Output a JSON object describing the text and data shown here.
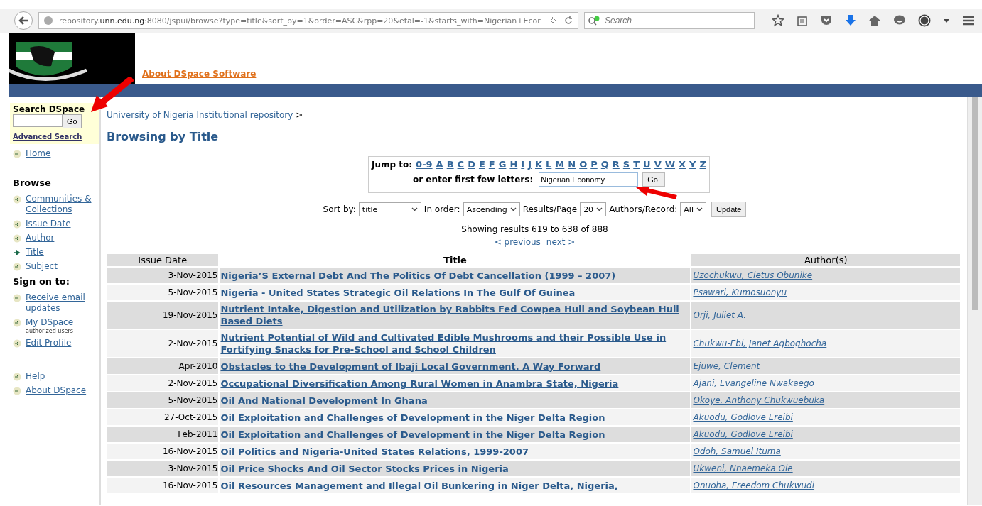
{
  "browser": {
    "url_host_pre": "repository.",
    "url_host": "unn.edu.ng",
    "url_rest": ":8080/jspui/browse?type=title&sort_by=1&order=ASC&rpp=20&etal=-1&starts_with=Nigerian+Ecor",
    "search_placeholder": "Search"
  },
  "header": {
    "about_link": "About DSpace Software"
  },
  "sidebar": {
    "search_title": "Search DSpace",
    "go": "Go",
    "advanced": "Advanced Search",
    "home": {
      "label": "Home",
      "selected": false
    },
    "browse_title": "Browse",
    "browse_items": [
      {
        "label": "Communities & Collections",
        "selected": false
      },
      {
        "label": "Issue Date",
        "selected": false
      },
      {
        "label": "Author",
        "selected": false
      },
      {
        "label": "Title",
        "selected": true
      },
      {
        "label": "Subject",
        "selected": false
      }
    ],
    "sign_title": "Sign on to:",
    "sign_items": [
      {
        "label": "Receive email updates",
        "selected": false
      },
      {
        "label": "My DSpace",
        "note": "authorized users",
        "selected": false
      },
      {
        "label": "Edit Profile",
        "selected": false
      }
    ],
    "help_items": [
      {
        "label": "Help",
        "selected": false
      },
      {
        "label": "About DSpace",
        "selected": false
      }
    ]
  },
  "breadcrumb": {
    "link": "University of Nigeria Institutional repository",
    "sep": ">"
  },
  "heading": "Browsing by Title",
  "jump": {
    "label": "Jump to:",
    "links": [
      "0-9",
      "A",
      "B",
      "C",
      "D",
      "E",
      "F",
      "G",
      "H",
      "I",
      "J",
      "K",
      "L",
      "M",
      "N",
      "O",
      "P",
      "Q",
      "R",
      "S",
      "T",
      "U",
      "V",
      "W",
      "X",
      "Y",
      "Z"
    ],
    "enter_label": "or enter first few letters:",
    "value": "Nigerian Economy",
    "go": "Go!"
  },
  "sort": [
    {
      "label": "Sort by:",
      "value": "title"
    },
    {
      "label": "In order:",
      "value": "Ascending"
    },
    {
      "label": "Results/Page",
      "value": "20"
    },
    {
      "label": "Authors/Record:",
      "value": "All"
    }
  ],
  "update": "Update",
  "showing": "Showing results 619 to 638 of 888",
  "prev": "< previous",
  "next": "next >",
  "table": {
    "columns": [
      "Issue Date",
      "Title",
      "Author(s)"
    ],
    "rows": [
      {
        "date": "3-Nov-2015",
        "title": "Nigeria’S External Debt And The Politics Of Debt Cancellation (1999 – 2007)",
        "author": "Uzochukwu, Cletus Obunike"
      },
      {
        "date": "5-Nov-2015",
        "title": "Nigeria - United States Strategic Oil Relations In The Gulf Of Guinea",
        "author": "Psawari, Kumosuonyu"
      },
      {
        "date": "19-Nov-2015",
        "title": "Nutrient Intake, Digestion and Utilization by Rabbits Fed Cowpea Hull and Soybean Hull Based Diets",
        "author": "Orji, Juliet A."
      },
      {
        "date": "2-Nov-2015",
        "title": "Nutrient Potential of Wild and Cultivated Edible Mushrooms and their Possible Use in Fortifying Snacks for Pre-School and School Children",
        "author": "Chukwu-Ebi, Janet Agboghocha"
      },
      {
        "date": "Apr-2010",
        "title": "Obstacles to the Development of Ibaji Local Government. A Way Forward",
        "author": "Ejuwe, Clement"
      },
      {
        "date": "2-Nov-2015",
        "title": "Occupational Diversification Among Rural Women in Anambra State, Nigeria",
        "author": "Ajani, Evangeline Nwakaego"
      },
      {
        "date": "5-Nov-2015",
        "title": "Oil And National Development In Ghana",
        "author": "Okoye, Anthony Chukwuebuka"
      },
      {
        "date": "27-Oct-2015",
        "title": "Oil Exploitation and Challenges of Development in the Niger Delta Region",
        "author": "Akuodu, Godlove Ereibi"
      },
      {
        "date": "Feb-2011",
        "title": "Oil Exploitation and Challenges of Development in the Niger Delta Region",
        "author": "Akuodu, Godlove Ereibi"
      },
      {
        "date": "16-Nov-2015",
        "title": "Oil Politics and Nigeria-United States Relations, 1999-2007",
        "author": "Odoh, Samuel Ituma"
      },
      {
        "date": "3-Nov-2015",
        "title": "Oil Price Shocks And Oil Sector Stocks Prices in Nigeria",
        "author": "Ukweni, Nnaemeka Ole"
      },
      {
        "date": "16-Nov-2015",
        "title": "Oil Resources Management and Illegal Oil Bunkering in Niger Delta, Nigeria,",
        "author": "Onuoha, Freedom Chukwudi"
      }
    ]
  }
}
